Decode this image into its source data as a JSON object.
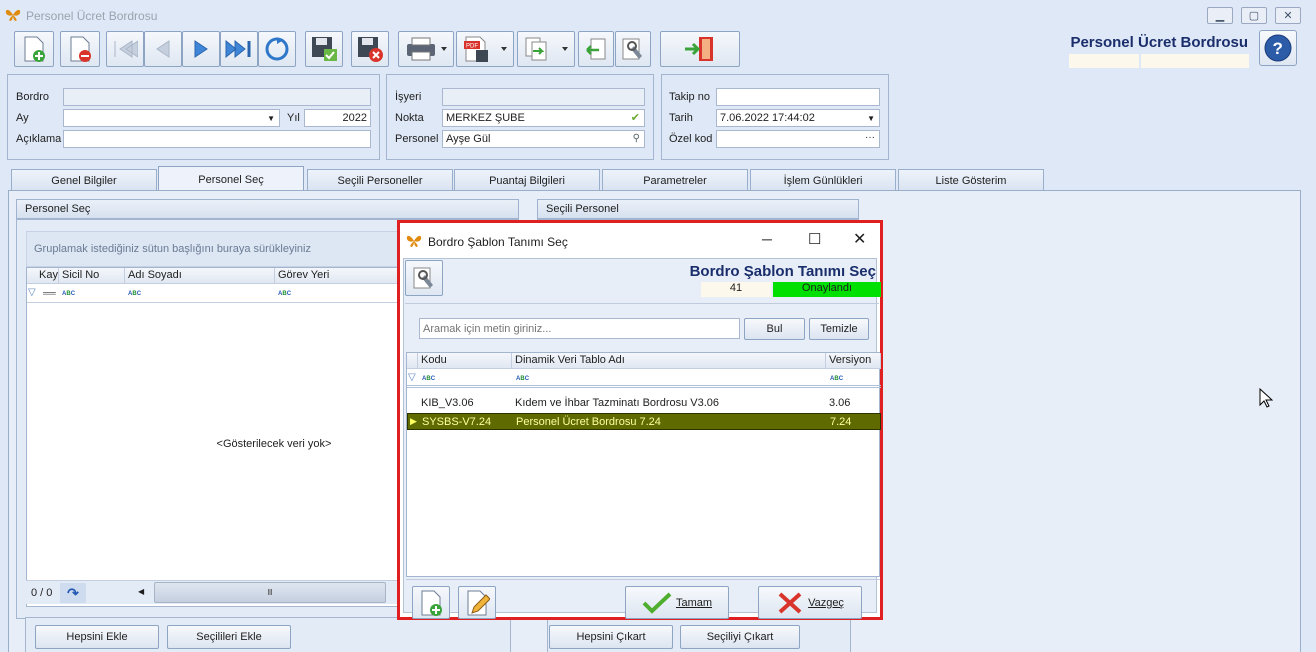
{
  "window": {
    "title": "Personel Ücret Bordrosu"
  },
  "header": {
    "title": "Personel Ücret Bordrosu"
  },
  "toolbar_icons": [
    "new-icon",
    "delete-icon",
    "first-icon",
    "prev-icon",
    "next-icon",
    "last-icon",
    "refresh-icon",
    "save-icon",
    "save-close-icon",
    "print-icon",
    "pdf-icon",
    "export-icon",
    "import-icon",
    "settings-icon",
    "exit-icon"
  ],
  "form": {
    "bordro_label": "Bordro",
    "bordro_value": "",
    "ay_label": "Ay",
    "ay_value": "",
    "yil_label": "Yıl",
    "yil_value": "2022",
    "aciklama_label": "Açıklama",
    "aciklama_value": "",
    "isyeri_label": "İşyeri",
    "isyeri_value": "",
    "nokta_label": "Nokta",
    "nokta_value": "MERKEZ ŞUBE",
    "personel_label": "Personel",
    "personel_value": "Ayşe Gül",
    "takip_label": "Takip no",
    "takip_value": "",
    "tarih_label": "Tarih",
    "tarih_value": "7.06.2022 17:44:02",
    "ozel_label": "Özel kod",
    "ozel_value": ""
  },
  "tabs": [
    "Genel Bilgiler",
    "Personel Seç",
    "Seçili Personeller",
    "Puantaj Bilgileri",
    "Parametreler",
    "İşlem Günlükleri",
    "Liste Gösterim"
  ],
  "left_panel": {
    "title": "Personel Seç",
    "group_hint": "Gruplamak istediğiniz sütun başlığını buraya sürükleyiniz",
    "columns": [
      "Kay",
      "Sicil No",
      "Adı Soyadı",
      "Görev Yeri"
    ],
    "empty_text": "<Gösterilecek veri yok>",
    "counter": "0 / 0",
    "btn_add_all": "Hepsini Ekle",
    "btn_add_selected": "Seçilileri Ekle"
  },
  "right_panel": {
    "title": "Seçili Personel",
    "btn_remove_all": "Hepsini Çıkart",
    "btn_remove_selected": "Seçiliyi Çıkart"
  },
  "dialog": {
    "title": "Bordro Şablon Tanımı Seç",
    "header_title": "Bordro Şablon Tanımı Seç",
    "record_no": "41",
    "status": "Onaylandı",
    "search_placeholder": "Aramak için metin giriniz...",
    "btn_find": "Bul",
    "btn_clear": "Temizle",
    "columns": [
      "Kodu",
      "Dinamik Veri Tablo Adı",
      "Versiyon"
    ],
    "rows": [
      {
        "kodu": "KIB_V3.06",
        "adi": "Kıdem ve İhbar Tazminatı Bordrosu V3.06",
        "versiyon": "3.06"
      },
      {
        "kodu": "SYSBS-V7.24",
        "adi": "Personel Ücret Bordrosu 7.24",
        "versiyon": "7.24"
      }
    ],
    "btn_ok": "Tamam",
    "btn_cancel": "Vazgeç"
  },
  "colors": {
    "status_green": "#00e000",
    "selected_row": "#5f6b00",
    "dialog_border": "#e02020",
    "title_blue": "#1a2e6c"
  }
}
